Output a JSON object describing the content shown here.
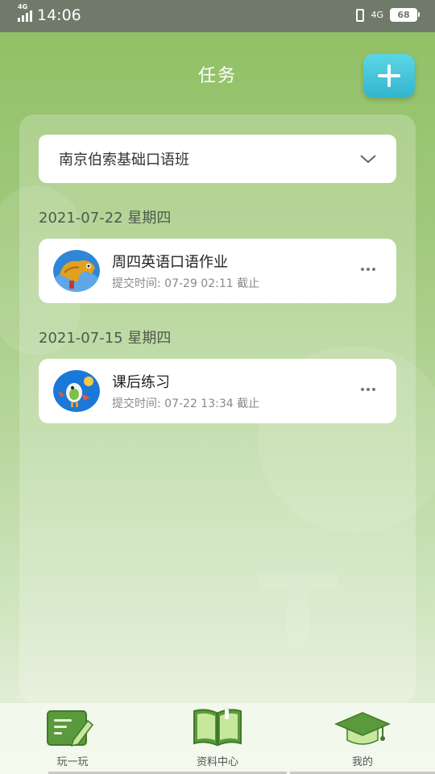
{
  "status_bar": {
    "network_left": "4G",
    "time": "14:06",
    "network_right": "4G",
    "battery": "68"
  },
  "header": {
    "title": "任务",
    "add_icon": "plus-icon"
  },
  "class_selector": {
    "value": "南京伯索基础口语班",
    "icon": "chevron-down-icon"
  },
  "task_groups": [
    {
      "date": "2021-07-22 星期四",
      "tasks": [
        {
          "name": "周四英语口语作业",
          "submit_info": "提交时间: 07-29 02:11 截止",
          "thumb_icon": "dragon-thumbnail",
          "more_icon": "more-dots-icon"
        }
      ]
    },
    {
      "date": "2021-07-15 星期四",
      "tasks": [
        {
          "name": "课后练习",
          "submit_info": "提交时间: 07-22 13:34 截止",
          "thumb_icon": "bird-thumbnail",
          "more_icon": "more-dots-icon"
        }
      ]
    }
  ],
  "tab_bar": {
    "tabs": [
      {
        "label": "玩一玩",
        "icon": "notepad-pencil-icon"
      },
      {
        "label": "资料中心",
        "icon": "open-book-icon"
      },
      {
        "label": "我的",
        "icon": "graduation-cap-icon"
      }
    ]
  },
  "colors": {
    "accent_button": "#33b5cf",
    "background_green": "#8fbf63"
  }
}
